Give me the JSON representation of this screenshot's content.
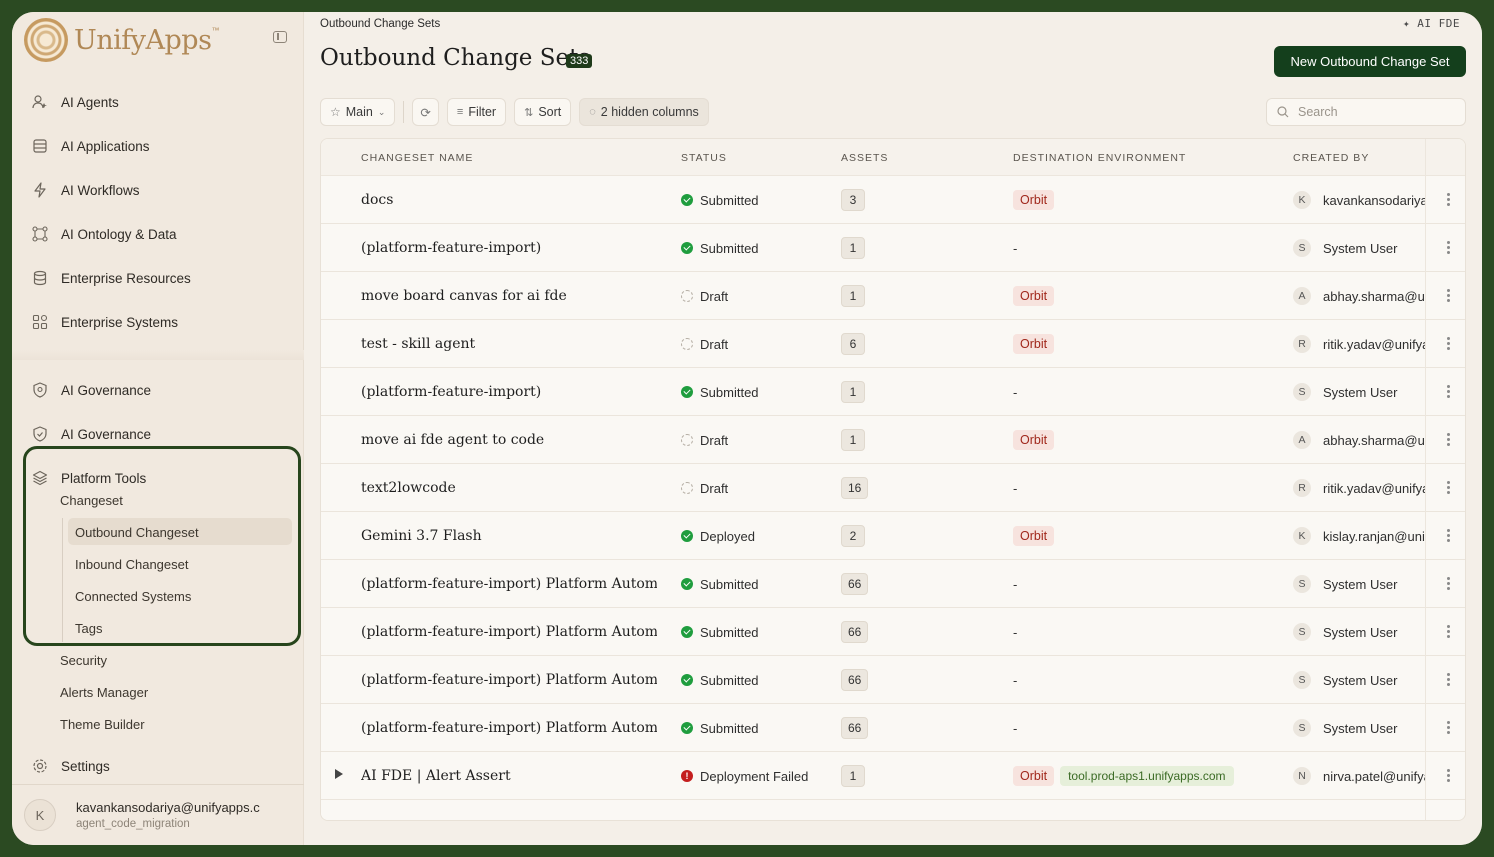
{
  "brand": {
    "name": "UnifyApps",
    "tm": "™"
  },
  "sidebar": {
    "nav": [
      {
        "label": "AI Agents",
        "icon": "agent-icon"
      },
      {
        "label": "AI Applications",
        "icon": "applications-icon"
      },
      {
        "label": "AI Workflows",
        "icon": "workflow-icon"
      },
      {
        "label": "AI Ontology & Data",
        "icon": "ontology-icon"
      },
      {
        "label": "Enterprise Resources",
        "icon": "database-icon"
      },
      {
        "label": "Enterprise Systems",
        "icon": "systems-icon"
      },
      {
        "label": "AI Governance",
        "icon": "shield-icon"
      },
      {
        "label": "AI Governance",
        "icon": "shield-check-icon"
      },
      {
        "label": "Platform Tools",
        "icon": "layers-icon"
      }
    ],
    "platform_sub": {
      "changeset": "Changeset",
      "children": [
        "Outbound Changeset",
        "Inbound Changeset",
        "Connected Systems",
        "Tags"
      ],
      "others": [
        "Security",
        "Alerts Manager",
        "Theme Builder"
      ]
    },
    "settings": "Settings",
    "user": {
      "initial": "K",
      "email": "kavankansodariya@unifyapps.c",
      "sub": "agent_code_migration"
    }
  },
  "header": {
    "breadcrumb": "Outbound Change Sets",
    "ai_fde": "✦ AI FDE",
    "title": "Outbound Change Sets",
    "count": "333",
    "new_button": "New Outbound Change Set"
  },
  "toolbar": {
    "view": "Main",
    "filter": "Filter",
    "sort": "Sort",
    "hidden": "2 hidden columns",
    "search_placeholder": "Search"
  },
  "table": {
    "columns": [
      "CHANGESET NAME",
      "STATUS",
      "ASSETS",
      "DESTINATION ENVIRONMENT",
      "CREATED BY"
    ],
    "rows": [
      {
        "name": "docs",
        "status": "Submitted",
        "kind": "ok",
        "assets": "3",
        "env": "Orbit",
        "url": "",
        "initial": "K",
        "by": "kavankansodariya@unifyapps.com"
      },
      {
        "name": "(platform-feature-import)",
        "status": "Submitted",
        "kind": "ok",
        "assets": "1",
        "env": "",
        "url": "",
        "initial": "S",
        "by": "System User"
      },
      {
        "name": "move board canvas for ai fde",
        "status": "Draft",
        "kind": "draft",
        "assets": "1",
        "env": "Orbit",
        "url": "",
        "initial": "A",
        "by": "abhay.sharma@unifyapps.com"
      },
      {
        "name": "test - skill agent",
        "status": "Draft",
        "kind": "draft",
        "assets": "6",
        "env": "Orbit",
        "url": "",
        "initial": "R",
        "by": "ritik.yadav@unifyapps.com"
      },
      {
        "name": "(platform-feature-import)",
        "status": "Submitted",
        "kind": "ok",
        "assets": "1",
        "env": "",
        "url": "",
        "initial": "S",
        "by": "System User"
      },
      {
        "name": "move ai fde agent to code",
        "status": "Draft",
        "kind": "draft",
        "assets": "1",
        "env": "Orbit",
        "url": "",
        "initial": "A",
        "by": "abhay.sharma@unifyapps.com"
      },
      {
        "name": "text2lowcode",
        "status": "Draft",
        "kind": "draft",
        "assets": "16",
        "env": "",
        "url": "",
        "initial": "R",
        "by": "ritik.yadav@unifyapps.com"
      },
      {
        "name": "Gemini 3.7 Flash",
        "status": "Deployed",
        "kind": "ok",
        "assets": "2",
        "env": "Orbit",
        "url": "",
        "initial": "K",
        "by": "kislay.ranjan@unifyapps.com"
      },
      {
        "name": "(platform-feature-import) Platform Autom...",
        "status": "Submitted",
        "kind": "ok",
        "assets": "66",
        "env": "",
        "url": "",
        "initial": "S",
        "by": "System User"
      },
      {
        "name": "(platform-feature-import) Platform Autom...",
        "status": "Submitted",
        "kind": "ok",
        "assets": "66",
        "env": "",
        "url": "",
        "initial": "S",
        "by": "System User"
      },
      {
        "name": "(platform-feature-import) Platform Autom...",
        "status": "Submitted",
        "kind": "ok",
        "assets": "66",
        "env": "",
        "url": "",
        "initial": "S",
        "by": "System User"
      },
      {
        "name": "(platform-feature-import) Platform Autom...",
        "status": "Submitted",
        "kind": "ok",
        "assets": "66",
        "env": "",
        "url": "",
        "initial": "S",
        "by": "System User"
      },
      {
        "name": "AI FDE | Alert Assert",
        "status": "Deployment Failed",
        "kind": "fail",
        "assets": "1",
        "env": "Orbit",
        "url": "tool.prod-aps1.unifyapps.com",
        "initial": "N",
        "by": "nirva.patel@unifyapps.com",
        "expandable": true
      }
    ],
    "empty_env": "-"
  },
  "colors": {
    "accent": "#143f1c",
    "highlight": "#27451c",
    "orbit_text": "#a0281c",
    "orbit_bg": "#f7e3de"
  }
}
